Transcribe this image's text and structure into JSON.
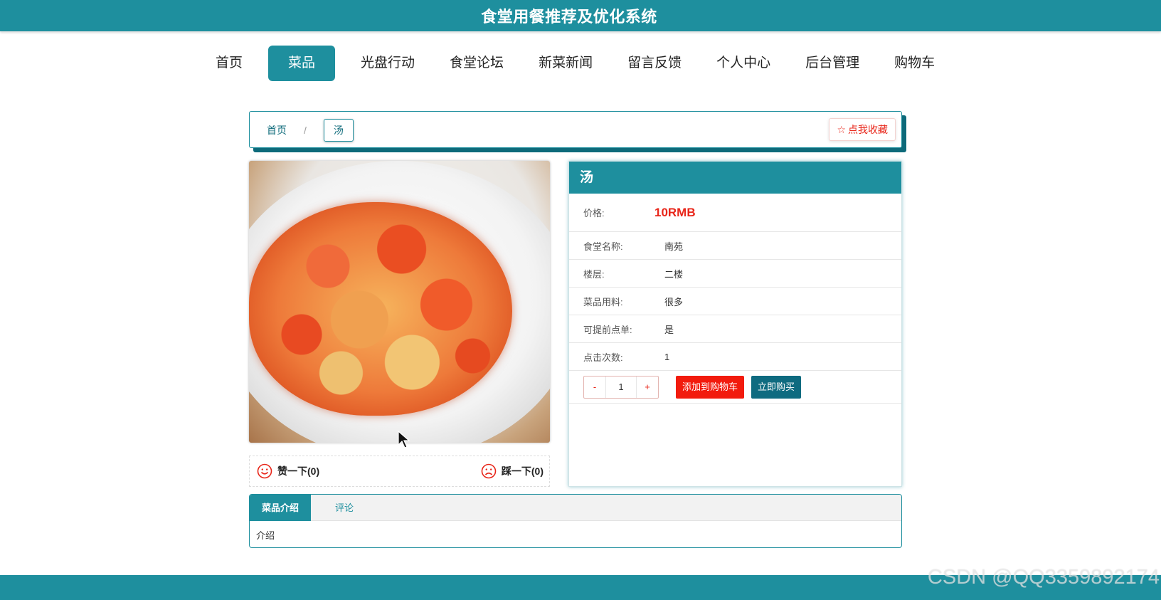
{
  "header": {
    "title": "食堂用餐推荐及优化系统"
  },
  "nav": {
    "items": [
      {
        "label": "首页"
      },
      {
        "label": "菜品",
        "active": true
      },
      {
        "label": "光盘行动"
      },
      {
        "label": "食堂论坛"
      },
      {
        "label": "新菜新闻"
      },
      {
        "label": "留言反馈"
      },
      {
        "label": "个人中心"
      },
      {
        "label": "后台管理"
      },
      {
        "label": "购物车"
      }
    ]
  },
  "breadcrumb": {
    "home": "首页",
    "separator": "/",
    "current": "汤"
  },
  "favorite": {
    "icon": "star-outline-icon",
    "label": "点我收藏"
  },
  "image": {
    "alt": "汤",
    "description_icon": "dish-photo"
  },
  "votes": {
    "like": {
      "icon": "smile-icon",
      "label": "赞一下(0)"
    },
    "dislike": {
      "icon": "frown-icon",
      "label": "踩一下(0)"
    }
  },
  "detail": {
    "title": "汤",
    "price": {
      "label": "价格:",
      "value": "10RMB"
    },
    "fields": [
      {
        "label": "食堂名称:",
        "value": "南苑"
      },
      {
        "label": "楼层:",
        "value": "二楼"
      },
      {
        "label": "菜品用料:",
        "value": "很多"
      },
      {
        "label": "可提前点单:",
        "value": "是"
      },
      {
        "label": "点击次数:",
        "value": "1"
      }
    ],
    "quantity": {
      "minus": "-",
      "value": "1",
      "plus": "+"
    },
    "add_to_cart": "添加到购物车",
    "buy_now": "立即购买"
  },
  "tabs": {
    "items": [
      {
        "label": "菜品介绍",
        "active": true
      },
      {
        "label": "评论"
      }
    ],
    "content": "介绍"
  },
  "watermark": "CSDN @QQ3359892174",
  "colors": {
    "primary": "#1e8f9e",
    "accent_red": "#e8261a",
    "buy_button": "#0f6b80"
  }
}
